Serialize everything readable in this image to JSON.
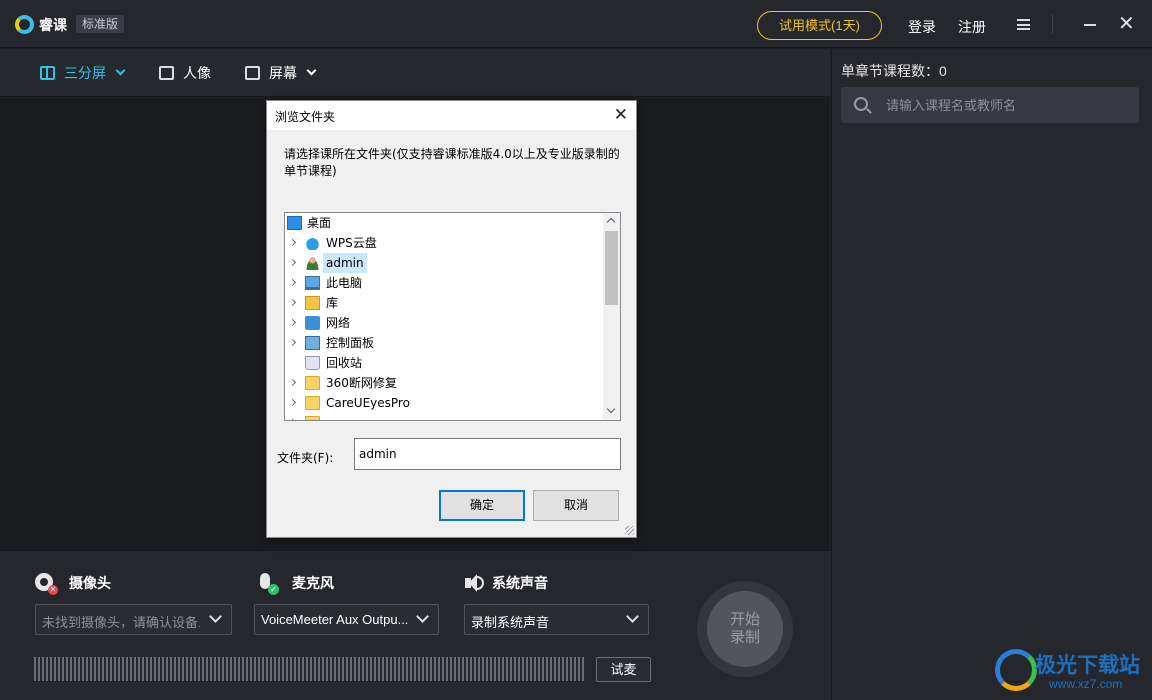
{
  "app": {
    "name": "睿课",
    "edition": "标准版",
    "trial": "试用模式(1天)",
    "login": "登录",
    "register": "注册"
  },
  "toolbar": {
    "split": "三分屏",
    "person": "人像",
    "screen": "屏幕"
  },
  "right_panel": {
    "chapter_count": "单章节课程数：0",
    "search_placeholder": "请输入课程名或教师名"
  },
  "devices": {
    "camera_title": "摄像头",
    "camera_value": "未找到摄像头，请确认设备...",
    "mic_title": "麦克风",
    "mic_value": "VoiceMeeter Aux Outpu...",
    "system_title": "系统声音",
    "system_value": "录制系统声音",
    "test_mic": "试麦",
    "record_line1": "开始",
    "record_line2": "录制"
  },
  "dialog": {
    "title": "浏览文件夹",
    "description": "请选择课所在文件夹(仅支持睿课标准版4.0以上及专业版录制的单节课程)",
    "tree": [
      {
        "label": "桌面",
        "icon": "desktop-icon"
      },
      {
        "label": "WPS云盘",
        "icon": "cloud-icon"
      },
      {
        "label": "admin",
        "icon": "user-icon"
      },
      {
        "label": "此电脑",
        "icon": "computer-icon"
      },
      {
        "label": "库",
        "icon": "library-icon"
      },
      {
        "label": "网络",
        "icon": "network-icon"
      },
      {
        "label": "控制面板",
        "icon": "control-panel-icon"
      },
      {
        "label": "回收站",
        "icon": "recycle-bin-icon"
      },
      {
        "label": "360断网修复",
        "icon": "folder-icon"
      },
      {
        "label": "CareUEyesPro",
        "icon": "folder-icon"
      }
    ],
    "folder_label": "文件夹(F):",
    "folder_value": "admin",
    "ok": "确定",
    "cancel": "取消"
  },
  "watermark": {
    "text": "极光下载站",
    "url": "www.xz7.com"
  },
  "colors": {
    "accent": "#37c1e6",
    "trial": "#f0c419",
    "background": "#1f2126",
    "dialog_focus": "#0078d7"
  }
}
